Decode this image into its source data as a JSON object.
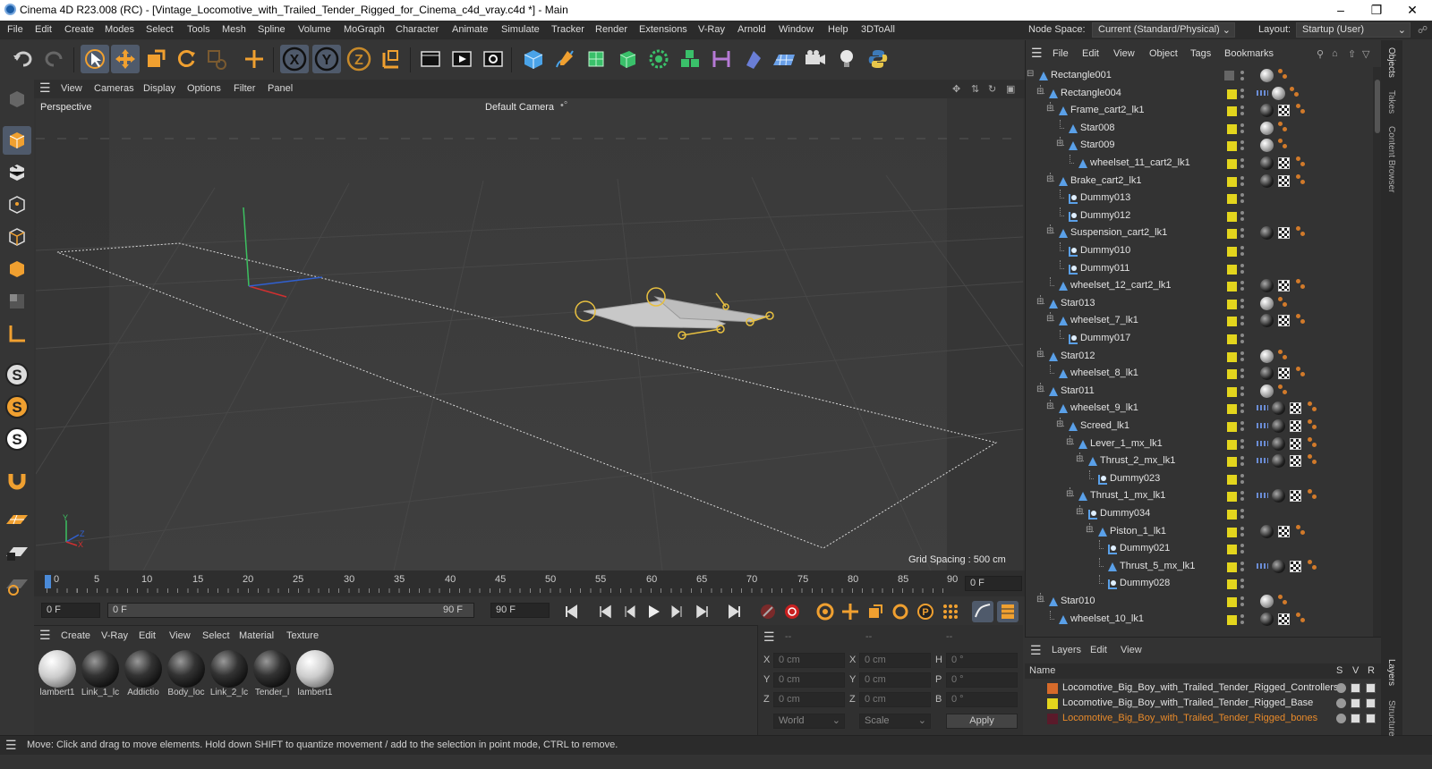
{
  "titlebar": {
    "title": "Cinema 4D R23.008 (RC) - [Vintage_Locomotive_with_Trailed_Tender_Rigged_for_Cinema_c4d_vray.c4d *] - Main"
  },
  "menu": [
    "File",
    "Edit",
    "Create",
    "Modes",
    "Select",
    "Tools",
    "Mesh",
    "Spline",
    "Volume",
    "MoGraph",
    "Character",
    "Animate",
    "Simulate",
    "Tracker",
    "Render",
    "Extensions",
    "V-Ray",
    "Arnold",
    "Window",
    "Help",
    "3DToAll"
  ],
  "node_space": {
    "label": "Node Space:",
    "value": "Current (Standard/Physical)"
  },
  "layout": {
    "label": "Layout:",
    "value": "Startup (User)"
  },
  "viewport": {
    "menu": [
      "View",
      "Cameras",
      "Display",
      "Options",
      "Filter",
      "Panel"
    ],
    "name": "Perspective",
    "camera": "Default Camera",
    "grid_spacing": "Grid Spacing : 500 cm"
  },
  "timeline": {
    "ticks": [
      "0",
      "5",
      "10",
      "15",
      "20",
      "25",
      "30",
      "35",
      "40",
      "45",
      "50",
      "55",
      "60",
      "65",
      "70",
      "75",
      "80",
      "85",
      "90"
    ],
    "current": "0 F"
  },
  "transport": {
    "start": "0 F",
    "range_start": "0 F",
    "range_end": "90 F",
    "end": "90 F"
  },
  "materials": {
    "menu": [
      "Create",
      "V-Ray",
      "Edit",
      "View",
      "Select",
      "Material",
      "Texture"
    ],
    "items": [
      {
        "name": "lambert1",
        "kind": "white"
      },
      {
        "name": "Link_1_lc",
        "kind": "dark"
      },
      {
        "name": "Addictio",
        "kind": "dark"
      },
      {
        "name": "Body_loc",
        "kind": "dark"
      },
      {
        "name": "Link_2_lc",
        "kind": "dark"
      },
      {
        "name": "Tender_l",
        "kind": "dark"
      },
      {
        "name": "lambert1",
        "kind": "white"
      }
    ]
  },
  "attributes": {
    "dashes": [
      "--",
      "--",
      "--"
    ],
    "rows": [
      {
        "a": "X",
        "av": "0 cm",
        "b": "X",
        "bv": "0 cm",
        "c": "H",
        "cv": "0 °"
      },
      {
        "a": "Y",
        "av": "0 cm",
        "b": "Y",
        "bv": "0 cm",
        "c": "P",
        "cv": "0 °"
      },
      {
        "a": "Z",
        "av": "0 cm",
        "b": "Z",
        "bv": "0 cm",
        "c": "B",
        "cv": "0 °"
      }
    ],
    "world": "World",
    "scale": "Scale",
    "apply": "Apply"
  },
  "status": "Move: Click and drag to move elements. Hold down SHIFT to quantize movement / add to the selection in point mode, CTRL to remove.",
  "objects": {
    "menu": [
      "File",
      "Edit",
      "View",
      "Object",
      "Tags",
      "Bookmarks"
    ],
    "rows": [
      {
        "name": "Rectangle001",
        "depth": 0,
        "icon": "bone",
        "tags": [
          "grey",
          "org"
        ]
      },
      {
        "name": "Rectangle004",
        "depth": 1,
        "icon": "bone",
        "tags": [
          "blu",
          "grey",
          "org"
        ]
      },
      {
        "name": "Frame_cart2_lk1",
        "depth": 2,
        "icon": "bone",
        "tags": [
          "dark",
          "chk",
          "org"
        ]
      },
      {
        "name": "Star008",
        "depth": 3,
        "icon": "bone",
        "tags": [
          "grey",
          "org"
        ]
      },
      {
        "name": "Star009",
        "depth": 3,
        "icon": "bone",
        "tags": [
          "grey",
          "org"
        ]
      },
      {
        "name": "wheelset_11_cart2_lk1",
        "depth": 4,
        "icon": "bone",
        "tags": [
          "dark",
          "chk",
          "org"
        ]
      },
      {
        "name": "Brake_cart2_lk1",
        "depth": 2,
        "icon": "bone",
        "tags": [
          "dark",
          "chk",
          "org"
        ]
      },
      {
        "name": "Dummy013",
        "depth": 3,
        "icon": "null",
        "tags": []
      },
      {
        "name": "Dummy012",
        "depth": 3,
        "icon": "null",
        "tags": []
      },
      {
        "name": "Suspension_cart2_lk1",
        "depth": 2,
        "icon": "bone",
        "tags": [
          "dark",
          "chk",
          "org"
        ]
      },
      {
        "name": "Dummy010",
        "depth": 3,
        "icon": "null",
        "tags": []
      },
      {
        "name": "Dummy011",
        "depth": 3,
        "icon": "null",
        "tags": []
      },
      {
        "name": "wheelset_12_cart2_lk1",
        "depth": 2,
        "icon": "bone",
        "tags": [
          "dark",
          "chk",
          "org"
        ]
      },
      {
        "name": "Star013",
        "depth": 1,
        "icon": "bone",
        "tags": [
          "grey",
          "org"
        ]
      },
      {
        "name": "wheelset_7_lk1",
        "depth": 2,
        "icon": "bone",
        "tags": [
          "dark",
          "chk",
          "org"
        ]
      },
      {
        "name": "Dummy017",
        "depth": 3,
        "icon": "null",
        "tags": []
      },
      {
        "name": "Star012",
        "depth": 1,
        "icon": "bone",
        "tags": [
          "grey",
          "org"
        ]
      },
      {
        "name": "wheelset_8_lk1",
        "depth": 2,
        "icon": "bone",
        "tags": [
          "dark",
          "chk",
          "org"
        ]
      },
      {
        "name": "Star011",
        "depth": 1,
        "icon": "bone",
        "tags": [
          "grey",
          "org"
        ]
      },
      {
        "name": "wheelset_9_lk1",
        "depth": 2,
        "icon": "bone",
        "tags": [
          "blu",
          "dark",
          "chk",
          "org"
        ]
      },
      {
        "name": "Screed_lk1",
        "depth": 3,
        "icon": "bone",
        "tags": [
          "blu",
          "dark",
          "chk",
          "org"
        ]
      },
      {
        "name": "Lever_1_mx_lk1",
        "depth": 4,
        "icon": "bone",
        "tags": [
          "blu",
          "dark",
          "chk",
          "org"
        ]
      },
      {
        "name": "Thrust_2_mx_lk1",
        "depth": 5,
        "icon": "bone",
        "tags": [
          "blu",
          "dark",
          "chk",
          "org"
        ]
      },
      {
        "name": "Dummy023",
        "depth": 6,
        "icon": "null",
        "tags": []
      },
      {
        "name": "Thrust_1_mx_lk1",
        "depth": 4,
        "icon": "bone",
        "tags": [
          "blu",
          "dark",
          "chk",
          "org"
        ]
      },
      {
        "name": "Dummy034",
        "depth": 5,
        "icon": "null",
        "tags": []
      },
      {
        "name": "Piston_1_lk1",
        "depth": 6,
        "icon": "bone",
        "tags": [
          "dark",
          "chk",
          "org"
        ]
      },
      {
        "name": "Dummy021",
        "depth": 7,
        "icon": "null",
        "tags": []
      },
      {
        "name": "Thrust_5_mx_lk1",
        "depth": 7,
        "icon": "bone",
        "tags": [
          "blu",
          "dark",
          "chk",
          "org"
        ]
      },
      {
        "name": "Dummy028",
        "depth": 7,
        "icon": "null",
        "tags": []
      },
      {
        "name": "Star010",
        "depth": 1,
        "icon": "bone",
        "tags": [
          "grey",
          "org"
        ]
      },
      {
        "name": "wheelset_10_lk1",
        "depth": 2,
        "icon": "bone",
        "tags": [
          "dark",
          "chk",
          "org"
        ]
      }
    ]
  },
  "layers": {
    "menu": [
      "Layers",
      "Edit",
      "View"
    ],
    "header": {
      "name": "Name",
      "s": "S",
      "v": "V",
      "r": "R"
    },
    "rows": [
      {
        "name": "Locomotive_Big_Boy_with_Trailed_Tender_Rigged_Controllers",
        "color": "#d66a2a",
        "text_color": "#e2e2e2"
      },
      {
        "name": "Locomotive_Big_Boy_with_Trailed_Tender_Rigged_Base",
        "color": "#e3d51d",
        "text_color": "#e2e2e2"
      },
      {
        "name": "Locomotive_Big_Boy_with_Trailed_Tender_Rigged_bones",
        "color": "#5a1a2a",
        "text_color": "#e88a2a"
      }
    ]
  },
  "right_tabs": [
    "Objects",
    "Takes",
    "Content Browser",
    "Layers",
    "Structure"
  ]
}
